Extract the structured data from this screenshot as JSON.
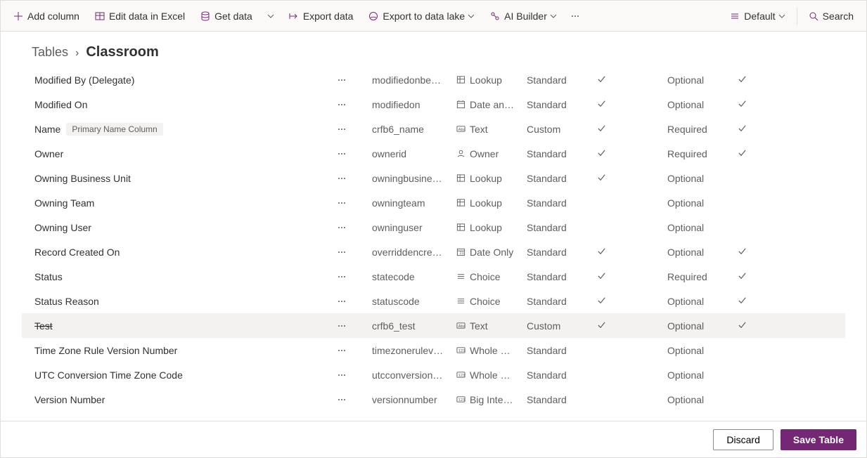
{
  "toolbar": {
    "add_column": "Add column",
    "edit_excel": "Edit data in Excel",
    "get_data": "Get data",
    "export_data": "Export data",
    "export_lake": "Export to data lake",
    "ai_builder": "AI Builder",
    "view": "Default",
    "search": "Search"
  },
  "breadcrumb": {
    "root": "Tables",
    "current": "Classroom"
  },
  "rows": [
    {
      "display": "Modified By (Delegate)",
      "badge": "",
      "strike": false,
      "highlight": false,
      "more": true,
      "logical": "modifiedonbe…",
      "type_icon": "lookup",
      "type_label": "Lookup",
      "kind": "Standard",
      "check1": true,
      "req": "Optional",
      "check2": true
    },
    {
      "display": "Modified On",
      "badge": "",
      "strike": false,
      "highlight": false,
      "more": true,
      "logical": "modifiedon",
      "type_icon": "datetime",
      "type_label": "Date an…",
      "kind": "Standard",
      "check1": true,
      "req": "Optional",
      "check2": true
    },
    {
      "display": "Name",
      "badge": "Primary Name Column",
      "strike": false,
      "highlight": false,
      "more": true,
      "logical": "crfb6_name",
      "type_icon": "text",
      "type_label": "Text",
      "kind": "Custom",
      "check1": true,
      "req": "Required",
      "check2": true
    },
    {
      "display": "Owner",
      "badge": "",
      "strike": false,
      "highlight": false,
      "more": true,
      "logical": "ownerid",
      "type_icon": "owner",
      "type_label": "Owner",
      "kind": "Standard",
      "check1": true,
      "req": "Required",
      "check2": true
    },
    {
      "display": "Owning Business Unit",
      "badge": "",
      "strike": false,
      "highlight": false,
      "more": true,
      "logical": "owningbusine…",
      "type_icon": "lookup",
      "type_label": "Lookup",
      "kind": "Standard",
      "check1": true,
      "req": "Optional",
      "check2": false
    },
    {
      "display": "Owning Team",
      "badge": "",
      "strike": false,
      "highlight": false,
      "more": true,
      "logical": "owningteam",
      "type_icon": "lookup",
      "type_label": "Lookup",
      "kind": "Standard",
      "check1": false,
      "req": "Optional",
      "check2": false
    },
    {
      "display": "Owning User",
      "badge": "",
      "strike": false,
      "highlight": false,
      "more": true,
      "logical": "owninguser",
      "type_icon": "lookup",
      "type_label": "Lookup",
      "kind": "Standard",
      "check1": false,
      "req": "Optional",
      "check2": false
    },
    {
      "display": "Record Created On",
      "badge": "",
      "strike": false,
      "highlight": false,
      "more": true,
      "logical": "overriddencre…",
      "type_icon": "dateonly",
      "type_label": "Date Only",
      "kind": "Standard",
      "check1": true,
      "req": "Optional",
      "check2": true
    },
    {
      "display": "Status",
      "badge": "",
      "strike": false,
      "highlight": false,
      "more": true,
      "logical": "statecode",
      "type_icon": "choice",
      "type_label": "Choice",
      "kind": "Standard",
      "check1": true,
      "req": "Required",
      "check2": true
    },
    {
      "display": "Status Reason",
      "badge": "",
      "strike": false,
      "highlight": false,
      "more": true,
      "logical": "statuscode",
      "type_icon": "choice",
      "type_label": "Choice",
      "kind": "Standard",
      "check1": true,
      "req": "Optional",
      "check2": true
    },
    {
      "display": "Test",
      "badge": "",
      "strike": true,
      "highlight": true,
      "more": true,
      "logical": "crfb6_test",
      "type_icon": "text",
      "type_label": "Text",
      "kind": "Custom",
      "check1": true,
      "req": "Optional",
      "check2": true
    },
    {
      "display": "Time Zone Rule Version Number",
      "badge": "",
      "strike": false,
      "highlight": false,
      "more": true,
      "logical": "timezonerulev…",
      "type_icon": "whole",
      "type_label": "Whole …",
      "kind": "Standard",
      "check1": false,
      "req": "Optional",
      "check2": false
    },
    {
      "display": "UTC Conversion Time Zone Code",
      "badge": "",
      "strike": false,
      "highlight": false,
      "more": true,
      "logical": "utcconversion…",
      "type_icon": "whole",
      "type_label": "Whole …",
      "kind": "Standard",
      "check1": false,
      "req": "Optional",
      "check2": false
    },
    {
      "display": "Version Number",
      "badge": "",
      "strike": false,
      "highlight": false,
      "more": true,
      "logical": "versionnumber",
      "type_icon": "bigint",
      "type_label": "Big Inte…",
      "kind": "Standard",
      "check1": false,
      "req": "Optional",
      "check2": false
    }
  ],
  "footer": {
    "discard": "Discard",
    "save": "Save Table"
  }
}
